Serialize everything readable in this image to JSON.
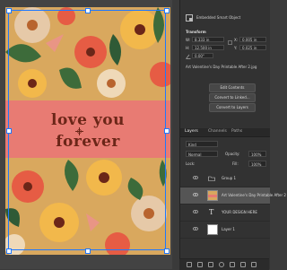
{
  "properties": {
    "object_type": "Embedded Smart Object",
    "section_transform": "Transform",
    "w_label": "W:",
    "w_value": "8.333 in",
    "x_label": "X:",
    "x_value": "0.005 in",
    "h_label": "H:",
    "h_value": "12.500 in",
    "y_label": "Y:",
    "y_value": "0.025 in",
    "angle_value": "0.00°",
    "file_path": "Art Valentine's Day Printable After 2.jpg",
    "buttons": [
      "Edit Contents",
      "Convert to Linked...",
      "Convert to Layers"
    ]
  },
  "layers_panel": {
    "tabs": [
      "Layers",
      "Channels",
      "Paths"
    ],
    "active_tab": "Layers",
    "filter_kind": "Kind",
    "blend_mode": "Normal",
    "opacity_label": "Opacity:",
    "opacity_value": "100%",
    "lock_label": "Lock:",
    "fill_label": "Fill:",
    "fill_value": "100%",
    "layers": [
      {
        "name": "Group 1",
        "type": "group"
      },
      {
        "name": "Art Valentine's Day Printable After 2",
        "type": "smart-object"
      },
      {
        "name": "YOUR DESIGN HERE",
        "type": "text"
      },
      {
        "name": "Layer 1",
        "type": "fill"
      }
    ]
  },
  "artwork": {
    "line1": "love you",
    "line2": "forever"
  },
  "colors": {
    "banner": "#e87b73",
    "text": "#6b2618",
    "selection": "#1e78ff",
    "panel_bg": "#323232"
  }
}
